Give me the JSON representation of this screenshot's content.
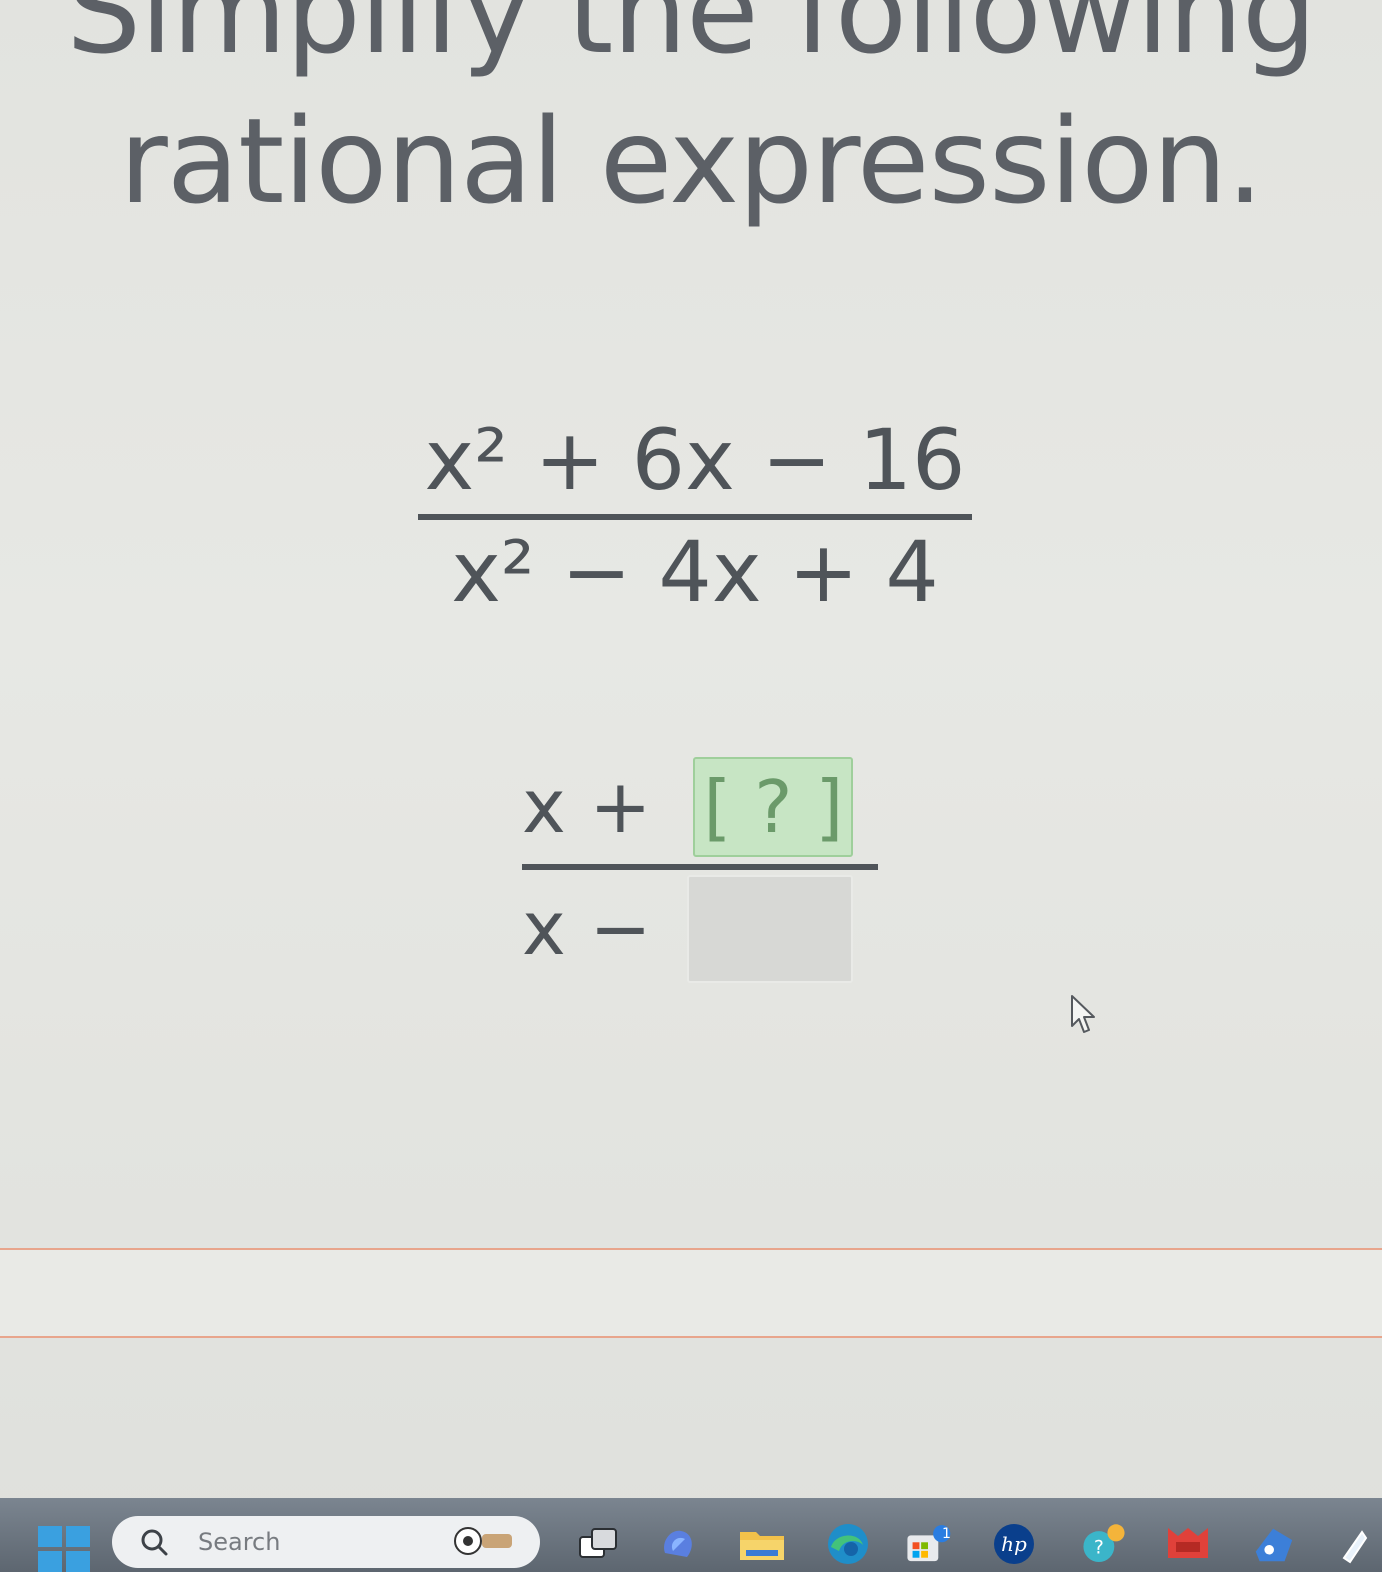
{
  "question": {
    "line1": "Simplify the following",
    "line2": "rational expression."
  },
  "problem": {
    "numerator": "x² + 6x − 16",
    "denominator": "x² − 4x + 4"
  },
  "answer": {
    "numerator_prefix": "x +",
    "active_box_open": "[",
    "active_box_mark": "?",
    "active_box_close": "]",
    "denominator_prefix": "x −"
  },
  "taskbar": {
    "search_placeholder": "Search",
    "notification_count": "1"
  },
  "colors": {
    "text": "#4f5459",
    "active_box": "#c7e5c4",
    "empty_box": "#d7d8d5",
    "rule": "#e8a58c",
    "taskbar": "#5d6670"
  }
}
